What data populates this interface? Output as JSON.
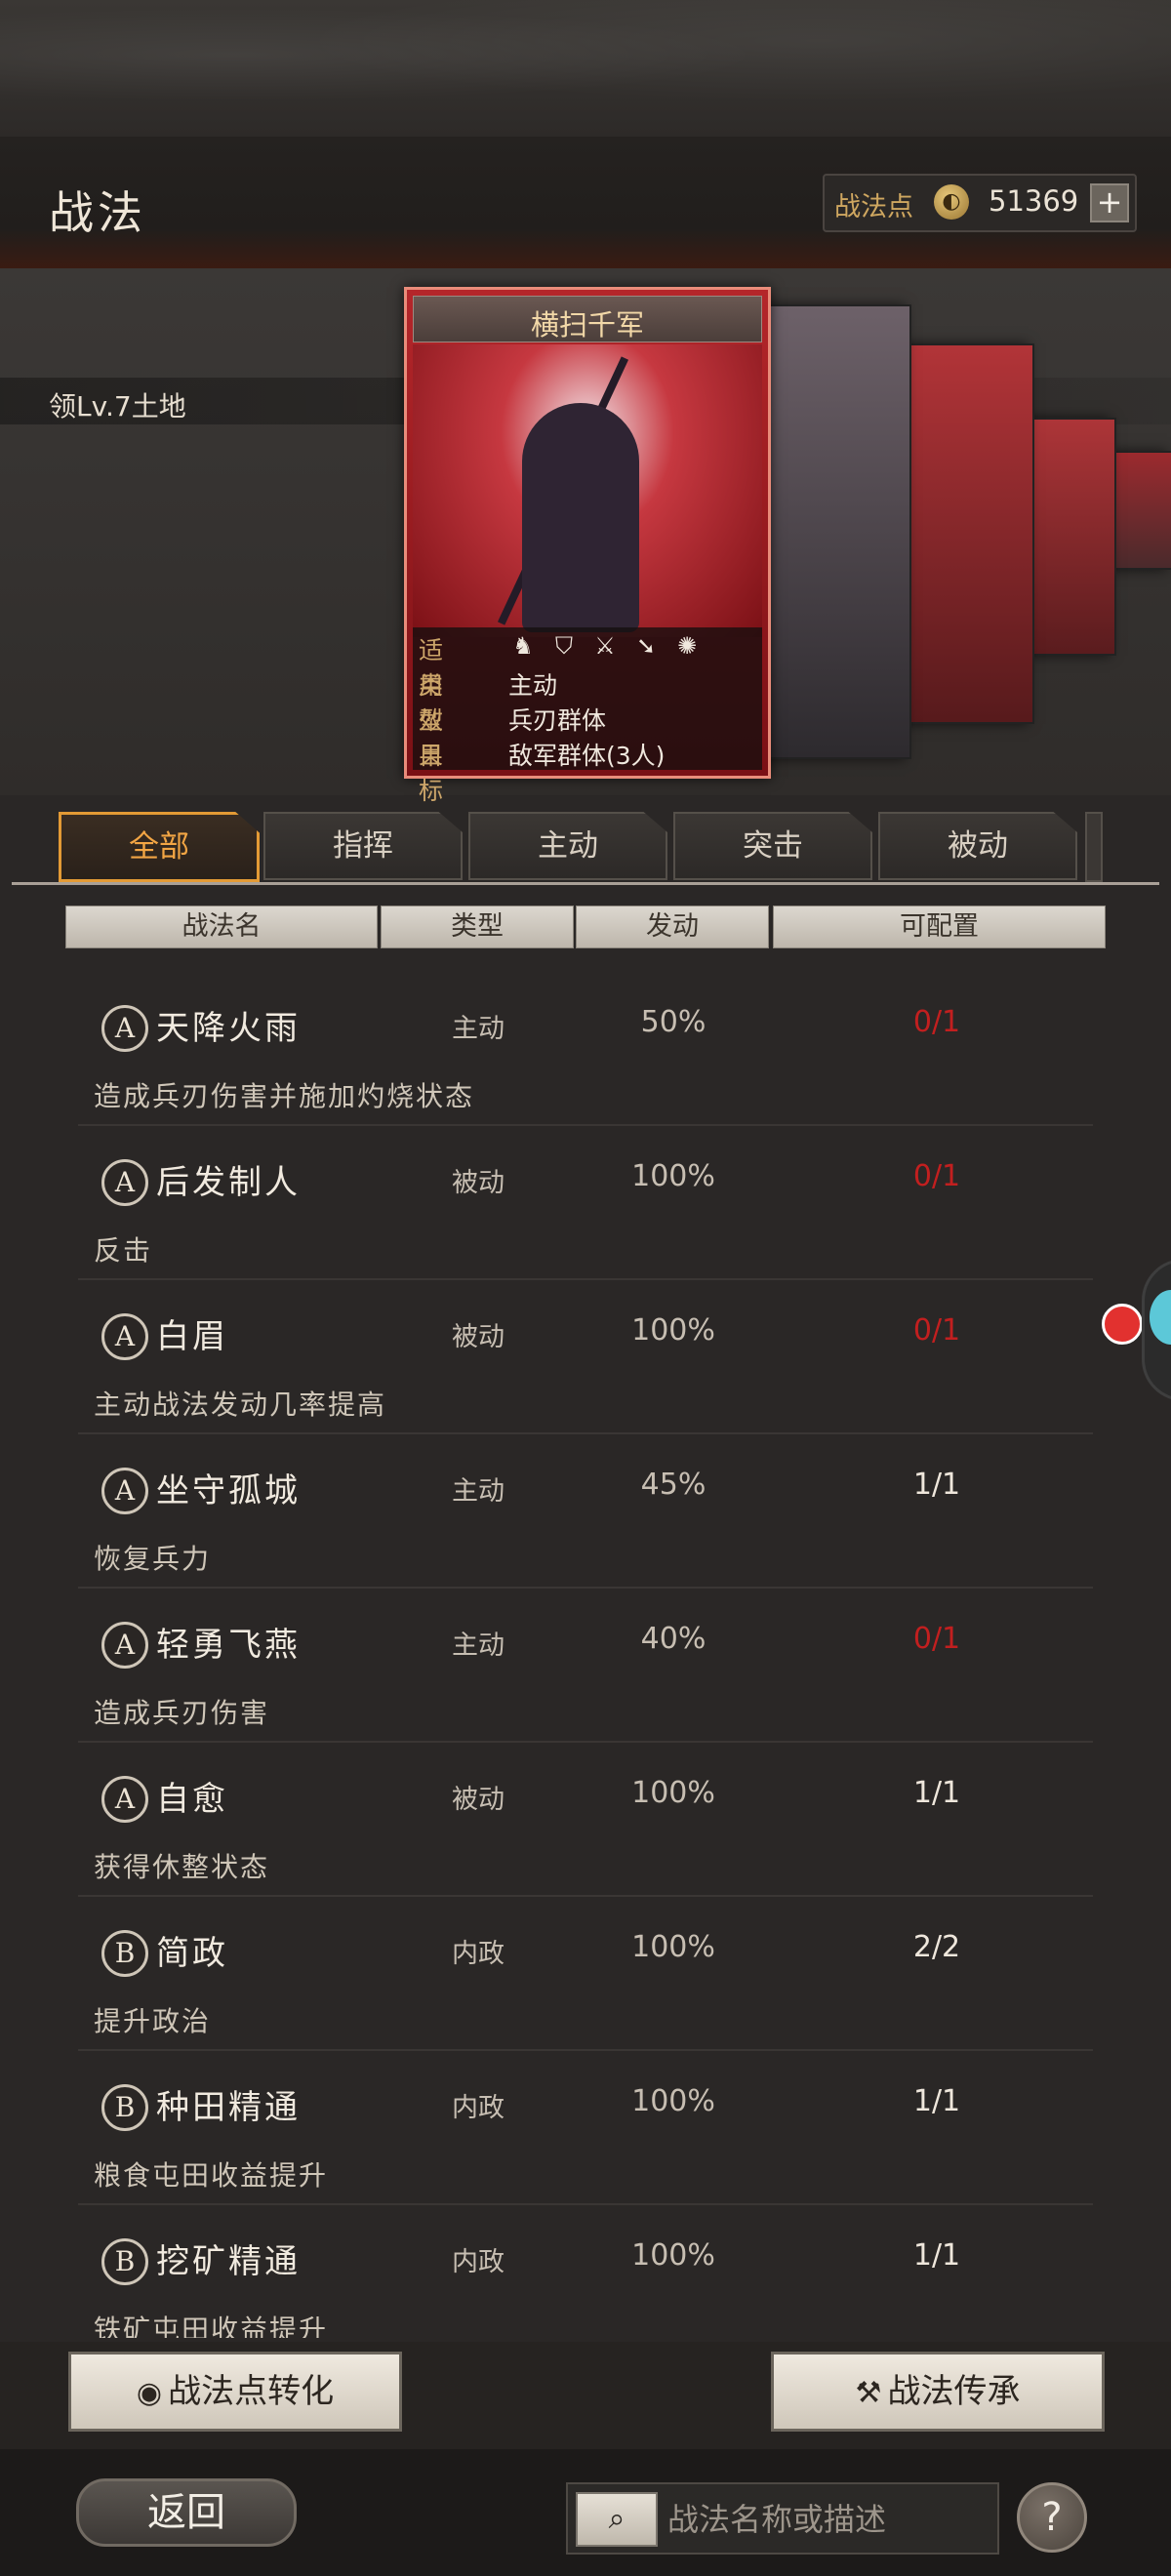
{
  "header": {
    "title": "战法"
  },
  "points": {
    "label": "战法点",
    "value": "51369",
    "plus": "+"
  },
  "land": {
    "label": "领Lv.7土地"
  },
  "card": {
    "name": "横扫千军",
    "rows": [
      {
        "key": "适用",
        "icons": [
          "cavalry-icon",
          "shield-icon",
          "crossed-weapons-icon",
          "spear-icon",
          "wheel-icon"
        ]
      },
      {
        "key": "类型",
        "value": "主动"
      },
      {
        "key": "效果",
        "value": "兵刃群体"
      },
      {
        "key": "目标",
        "value": "敌军群体(3人)"
      }
    ]
  },
  "tabs": [
    "全部",
    "指挥",
    "主动",
    "突击",
    "被动"
  ],
  "columns": [
    "战法名",
    "类型",
    "发动",
    "可配置"
  ],
  "skills": [
    {
      "grade": "A",
      "name": "天降火雨",
      "type": "主动",
      "rate": "50%",
      "config": "0/1",
      "desc": "造成兵刃伤害并施加灼烧状态"
    },
    {
      "grade": "A",
      "name": "后发制人",
      "type": "被动",
      "rate": "100%",
      "config": "0/1",
      "desc": "反击"
    },
    {
      "grade": "A",
      "name": "白眉",
      "type": "被动",
      "rate": "100%",
      "config": "0/1",
      "desc": "主动战法发动几率提高"
    },
    {
      "grade": "A",
      "name": "坐守孤城",
      "type": "主动",
      "rate": "45%",
      "config": "1/1",
      "desc": "恢复兵力"
    },
    {
      "grade": "A",
      "name": "轻勇飞燕",
      "type": "主动",
      "rate": "40%",
      "config": "0/1",
      "desc": "造成兵刃伤害"
    },
    {
      "grade": "A",
      "name": "自愈",
      "type": "被动",
      "rate": "100%",
      "config": "1/1",
      "desc": "获得休整状态"
    },
    {
      "grade": "B",
      "name": "简政",
      "type": "内政",
      "rate": "100%",
      "config": "2/2",
      "desc": "提升政治"
    },
    {
      "grade": "B",
      "name": "种田精通",
      "type": "内政",
      "rate": "100%",
      "config": "1/1",
      "desc": "粮食屯田收益提升"
    },
    {
      "grade": "B",
      "name": "挖矿精通",
      "type": "内政",
      "rate": "100%",
      "config": "1/1",
      "desc": "铁矿屯田收益提升"
    }
  ],
  "actions": {
    "convert": "战法点转化",
    "inherit": "战法传承"
  },
  "footer": {
    "back": "返回",
    "search_placeholder": "战法名称或描述",
    "help": "?"
  },
  "colors": {
    "accent": "#e39a35",
    "unavailable": "#c21f1f"
  }
}
